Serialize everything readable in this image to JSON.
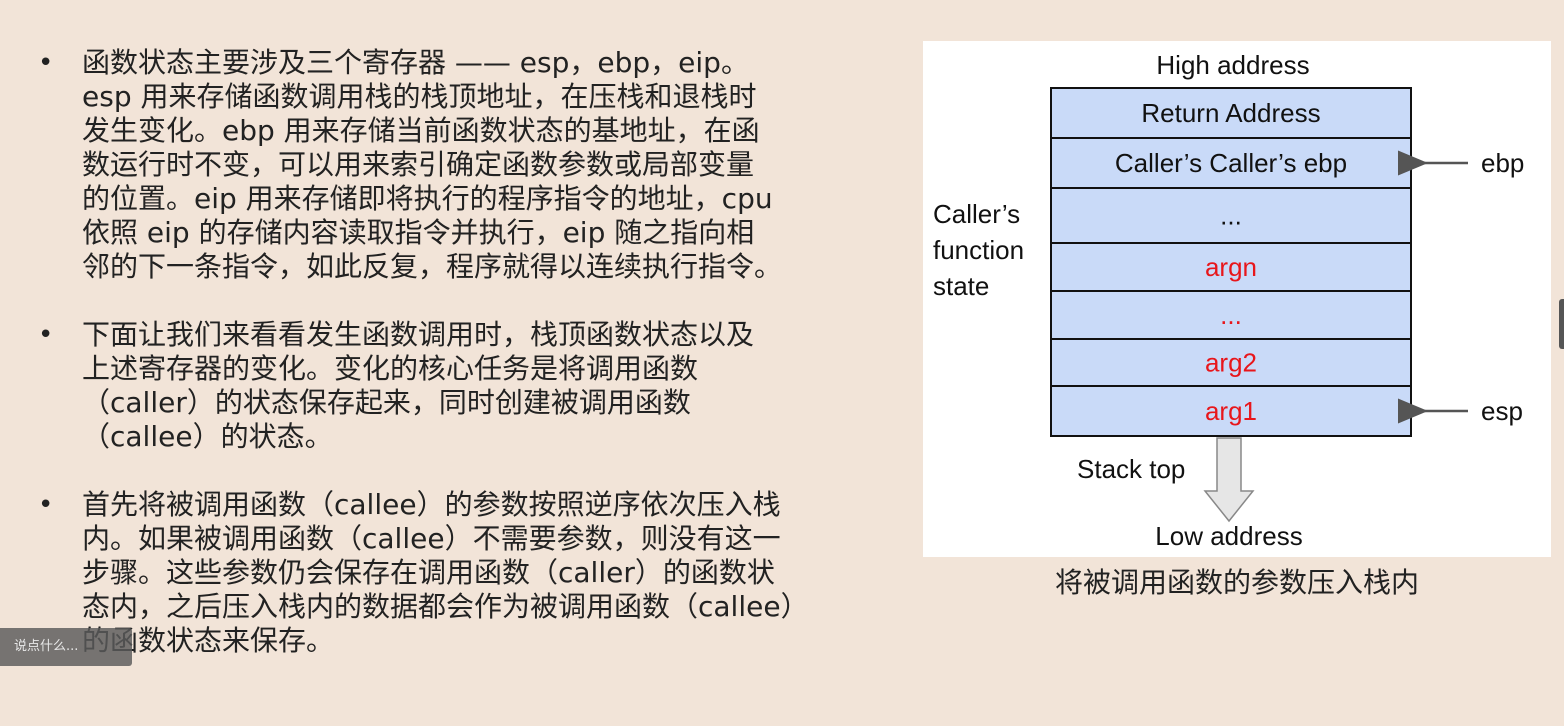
{
  "bullets": [
    {
      "lines": [
        "函数状态主要涉及三个寄存器 —— esp，ebp，eip。",
        "esp 用来存储函数调用栈的栈顶地址，在压栈和退栈时",
        "发生变化。ebp 用来存储当前函数状态的基地址，在函",
        "数运行时不变，可以用来索引确定函数参数或局部变量",
        "的位置。eip 用来存储即将执行的程序指令的地址，cpu",
        "依照 eip 的存储内容读取指令并执行，eip 随之指向相",
        "邻的下一条指令，如此反复，程序就得以连续执行指令。"
      ]
    },
    {
      "lines": [
        "下面让我们来看看发生函数调用时，栈顶函数状态以及",
        "上述寄存器的变化。变化的核心任务是将调用函数",
        "（caller）的状态保存起来，同时创建被调用函数",
        "（callee）的状态。"
      ]
    },
    {
      "lines": [
        "首先将被调用函数（callee）的参数按照逆序依次压入栈",
        "内。如果被调用函数（callee）不需要参数，则没有这一",
        "步骤。这些参数仍会保存在调用函数（caller）的函数状",
        "态内，之后压入栈内的数据都会作为被调用函数（callee）",
        "的函数状态来保存。"
      ]
    }
  ],
  "bullet_glyph": "•",
  "diagram": {
    "high_label": "High address",
    "low_label": "Low address",
    "stack_top_label": "Stack top",
    "side_label_lines": [
      "Caller’s",
      "function",
      "state"
    ],
    "cells": [
      {
        "text": "Return Address",
        "color": "#111111"
      },
      {
        "text": "Caller’s Caller’s ebp",
        "color": "#111111"
      },
      {
        "text": "...",
        "color": "#111111"
      },
      {
        "text": "argn",
        "color": "#e8161b"
      },
      {
        "text": "...",
        "color": "#e8161b"
      },
      {
        "text": "arg2",
        "color": "#e8161b"
      },
      {
        "text": "arg1",
        "color": "#e8161b"
      }
    ],
    "pointers": [
      {
        "label": "ebp",
        "cell_index": 1
      },
      {
        "label": "esp",
        "cell_index": 6
      }
    ],
    "cell_fill": "#c9daf8"
  },
  "caption": "将被调用函数的参数压入栈内",
  "comment_box": {
    "placeholder": "说点什么..."
  },
  "colors": {
    "background": "#f2e4d8",
    "panel": "#ffffff",
    "arg_red": "#e8161b"
  }
}
